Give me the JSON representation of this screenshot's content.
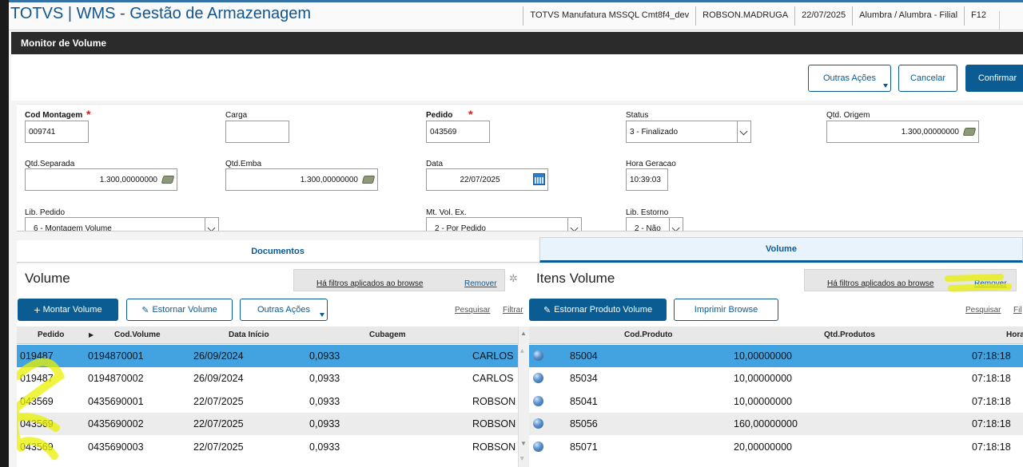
{
  "app": {
    "title": "TOTVS | WMS - Gestão de Armazenagem",
    "env": "TOTVS Manufatura MSSQL Cmt8f4_dev",
    "user": "ROBSON.MADRUGA",
    "date": "22/07/2025",
    "branch": "Alumbra / Alumbra - Filial",
    "help_key": "F12"
  },
  "dialog": {
    "title": "Monitor de Volume",
    "buttons": {
      "outras_acoes": "Outras Ações",
      "cancelar": "Cancelar",
      "confirmar": "Confirmar"
    }
  },
  "form": {
    "cod_montagem": {
      "label": "Cod Montagem",
      "value": "009741",
      "required": true
    },
    "carga": {
      "label": "Carga",
      "value": ""
    },
    "pedido": {
      "label": "Pedido",
      "value": "043569",
      "required": true
    },
    "status": {
      "label": "Status",
      "value": "3 - Finalizado"
    },
    "qtd_origem": {
      "label": "Qtd. Origem",
      "value": "1.300,00000000"
    },
    "qtd_separada": {
      "label": "Qtd.Separada",
      "value": "1.300,00000000"
    },
    "qtd_emba": {
      "label": "Qtd.Emba",
      "value": "1.300,00000000"
    },
    "data": {
      "label": "Data",
      "value": "22/07/2025"
    },
    "hora_geracao": {
      "label": "Hora Geracao",
      "value": "10:39:03"
    },
    "lib_pedido": {
      "label": "Lib. Pedido",
      "value": "6 - Montagem Volume"
    },
    "mt_vol_ex": {
      "label": "Mt. Vol. Ex.",
      "value": "2 - Por Pedido"
    },
    "lib_estorno": {
      "label": "Lib. Estorno",
      "value": "2 - Não"
    }
  },
  "tabs": {
    "documentos": "Documentos",
    "volume": "Volume"
  },
  "left_panel": {
    "title": "Volume",
    "filter_text": "Há filtros aplicados ao browse",
    "filter_remove": "Remover",
    "btn_montar": "Montar Volume",
    "btn_estornar": "Estornar Volume",
    "btn_outras": "Outras Ações",
    "pesquisar": "Pesquisar",
    "filtrar": "Filtrar",
    "columns": [
      "Pedido",
      "Cod.Volume",
      "Data Início",
      "Cubagem"
    ],
    "rows": [
      {
        "pedido": "019487",
        "cod_volume": "0194870001",
        "data_inicio": "26/09/2024",
        "cubagem": "0,0933",
        "usuario": "CARLOS"
      },
      {
        "pedido": "019487",
        "cod_volume": "0194870002",
        "data_inicio": "26/09/2024",
        "cubagem": "0,0933",
        "usuario": "CARLOS"
      },
      {
        "pedido": "043569",
        "cod_volume": "0435690001",
        "data_inicio": "22/07/2025",
        "cubagem": "0,0933",
        "usuario": "ROBSON"
      },
      {
        "pedido": "043569",
        "cod_volume": "0435690002",
        "data_inicio": "22/07/2025",
        "cubagem": "0,0933",
        "usuario": "ROBSON"
      },
      {
        "pedido": "043569",
        "cod_volume": "0435690003",
        "data_inicio": "22/07/2025",
        "cubagem": "0,0933",
        "usuario": "ROBSON"
      }
    ]
  },
  "right_panel": {
    "title": "Itens Volume",
    "filter_text": "Há filtros aplicados ao browse",
    "filter_remove": "Remover",
    "btn_estornar_produto": "Estornar Produto Volume",
    "btn_imprimir": "Imprimir Browse",
    "pesquisar": "Pesquisar",
    "filtrar": "Fil",
    "columns": [
      "Cod.Produto",
      "Qtd.Produtos",
      "Hora"
    ],
    "rows": [
      {
        "cod_produto": "85004",
        "qtd": "10,00000000",
        "hora": "07:18:18"
      },
      {
        "cod_produto": "85034",
        "qtd": "10,00000000",
        "hora": "07:18:18"
      },
      {
        "cod_produto": "85041",
        "qtd": "10,00000000",
        "hora": "07:18:18"
      },
      {
        "cod_produto": "85056",
        "qtd": "160,00000000",
        "hora": "07:18:18"
      },
      {
        "cod_produto": "85071",
        "qtd": "20,00000000",
        "hora": "07:18:18"
      }
    ]
  },
  "colors": {
    "accent": "#0b5c93",
    "selected_row": "#42a3e0",
    "highlighter": "#e8f000"
  }
}
